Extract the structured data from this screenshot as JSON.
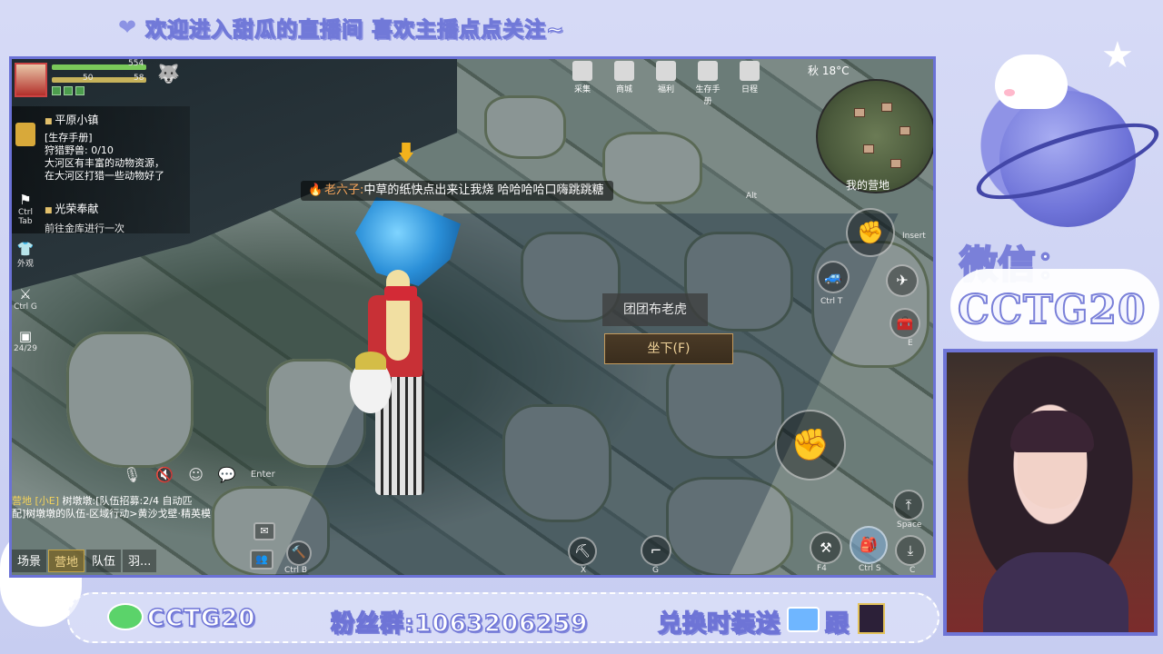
{
  "overlay": {
    "banner_text": "欢迎进入甜瓜的直播间 喜欢主播点点关注~",
    "wechat_label": "微信：",
    "wechat_id": "CCTG20",
    "bottom_wechat": "CCTG20",
    "fan_group": "粉丝群:1063206259",
    "exchange_text": "兑换时装送",
    "follow_text": "跟"
  },
  "hud": {
    "hp_value": "554",
    "stamina_value": "50",
    "stamina_value2": "58",
    "weather": "秋 18°C",
    "my_camp": "我的营地"
  },
  "quest": {
    "title": "平原小镇",
    "lines": [
      "[生存手册]",
      "狩猎野兽: 0/10",
      "大河区有丰富的动物资源，",
      "在大河区打猎一些动物好了"
    ],
    "title2": "光荣奉献",
    "line2": "前往金库进行一次"
  },
  "side_icons": [
    {
      "label": "Ctrl Tab"
    },
    {
      "label": "外观"
    },
    {
      "label": "Ctrl G"
    },
    {
      "label": "24/29"
    }
  ],
  "chat_bubble": {
    "speaker": "老六子:",
    "message": "中草的纸快点出来让我烧 哈哈哈哈口嗨跳跳糖"
  },
  "top_menu": [
    {
      "label": "采集"
    },
    {
      "label": "商城"
    },
    {
      "label": "福利"
    },
    {
      "label": "生存手册"
    },
    {
      "label": "日程"
    }
  ],
  "interact": {
    "target_name": "团团布老虎",
    "action": "坐下(F)"
  },
  "right_keys": {
    "insert": "Insert",
    "ctrl_t": "Ctrl T",
    "e": "E",
    "space": "Space",
    "f4": "F4",
    "ctrl_s": "Ctrl S",
    "c": "C",
    "g": "G",
    "x": "X",
    "ctrl_b": "Ctrl B",
    "alt": "Alt"
  },
  "bottom_chat": {
    "line1_tag": "营地",
    "line1_name": "[小E]",
    "line1_text": "树墩墩:[队伍招募:2/4 自动匹",
    "line2_text": "配]树墩墩的队伍-区域行动>黄沙戈壁·精英模",
    "enter_label": "Enter",
    "tabs": [
      "场景",
      "营地",
      "队伍",
      "羽..."
    ],
    "active_tab": "营地"
  }
}
